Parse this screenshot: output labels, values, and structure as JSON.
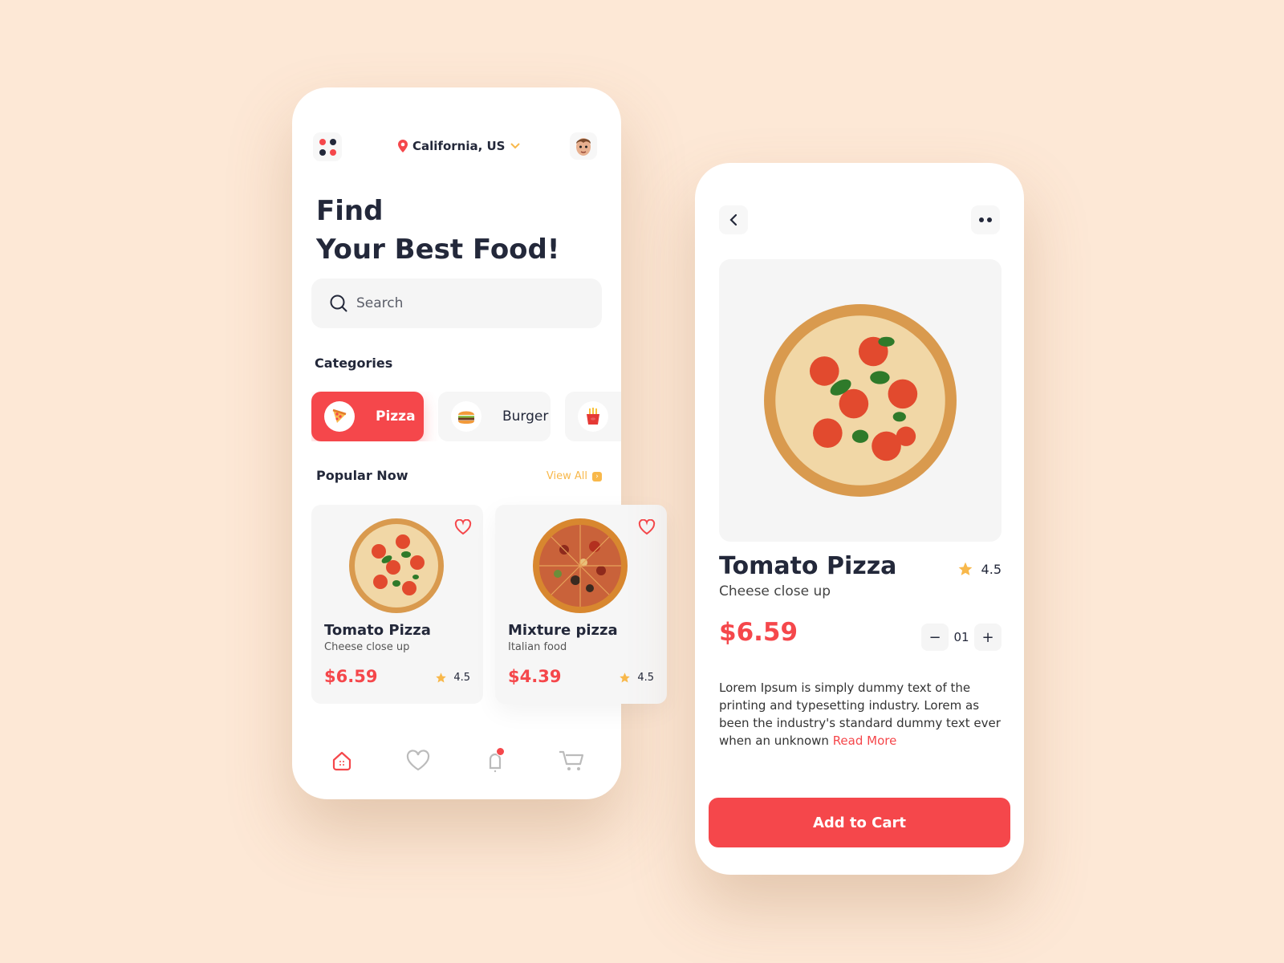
{
  "colors": {
    "background": "#fde8d6",
    "accent": "#f5474b",
    "star": "#f8b84b",
    "text": "#23283a"
  },
  "home": {
    "menu_icon": "grid-dots-icon",
    "location": "California, US",
    "location_icon": "map-pin-icon",
    "title_line1": "Find",
    "title_line2": "Your Best Food!",
    "search": {
      "placeholder": "Search",
      "value": ""
    },
    "categories_label": "Categories",
    "categories": [
      {
        "label": "Pizza",
        "icon": "pizza-slice-icon",
        "active": true
      },
      {
        "label": "Burger",
        "icon": "burger-icon",
        "active": false
      },
      {
        "label": "",
        "icon": "fries-icon",
        "active": false
      }
    ],
    "popular_label": "Popular Now",
    "view_all": "View All",
    "items": [
      {
        "name": "Tomato Pizza",
        "subtitle": "Cheese close up",
        "price": "$6.59",
        "rating": "4.5"
      },
      {
        "name": "Mixture pizza",
        "subtitle": "Italian food",
        "price": "$4.39",
        "rating": "4.5"
      }
    ],
    "nav": [
      {
        "name": "home",
        "icon": "home-icon",
        "active": true
      },
      {
        "name": "favorites",
        "icon": "heart-icon",
        "active": false
      },
      {
        "name": "notifications",
        "icon": "bell-icon",
        "active": false,
        "badge": "1"
      },
      {
        "name": "cart",
        "icon": "cart-icon",
        "active": false
      }
    ]
  },
  "detail": {
    "name": "Tomato Pizza",
    "subtitle": "Cheese close up",
    "rating": "4.5",
    "price": "$6.59",
    "quantity": "01",
    "description": "Lorem Ipsum is simply dummy text of the printing and typesetting industry. Lorem as been the industry's standard dummy text ever when an unknown ",
    "read_more": "Read More",
    "cta": "Add to Cart"
  }
}
